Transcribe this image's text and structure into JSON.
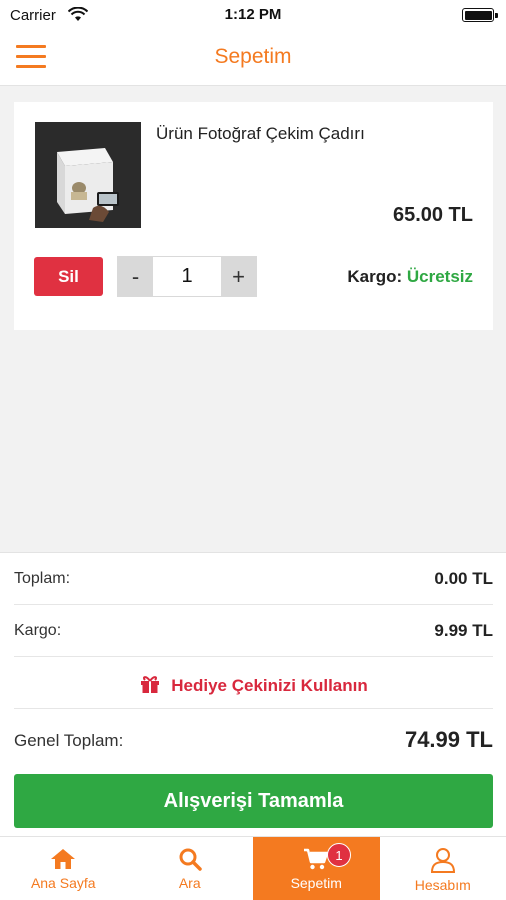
{
  "status_bar": {
    "carrier": "Carrier",
    "time": "1:12 PM"
  },
  "nav": {
    "title": "Sepetim"
  },
  "cart_item": {
    "name": "Ürün Fotoğraf Çekim Çadırı",
    "price": "65.00 TL",
    "delete_label": "Sil",
    "minus": "-",
    "plus": "+",
    "quantity": "1",
    "shipping_label": "Kargo:",
    "shipping_value": "Ücretsiz"
  },
  "summary": {
    "subtotal_label": "Toplam:",
    "subtotal_value": "0.00 TL",
    "shipping_label": "Kargo:",
    "shipping_value": "9.99 TL",
    "gift_label": "Hediye Çekinizi Kullanın",
    "total_label": "Genel Toplam:",
    "total_value": "74.99 TL",
    "checkout_label": "Alışverişi Tamamla"
  },
  "tabs": [
    {
      "label": "Ana Sayfa",
      "icon": "home-icon"
    },
    {
      "label": "Ara",
      "icon": "search-icon"
    },
    {
      "label": "Sepetim",
      "icon": "cart-icon",
      "badge": "1"
    },
    {
      "label": "Hesabım",
      "icon": "user-icon"
    }
  ],
  "colors": {
    "accent": "#f47a20",
    "danger": "#e03141",
    "success": "#2fa843"
  }
}
